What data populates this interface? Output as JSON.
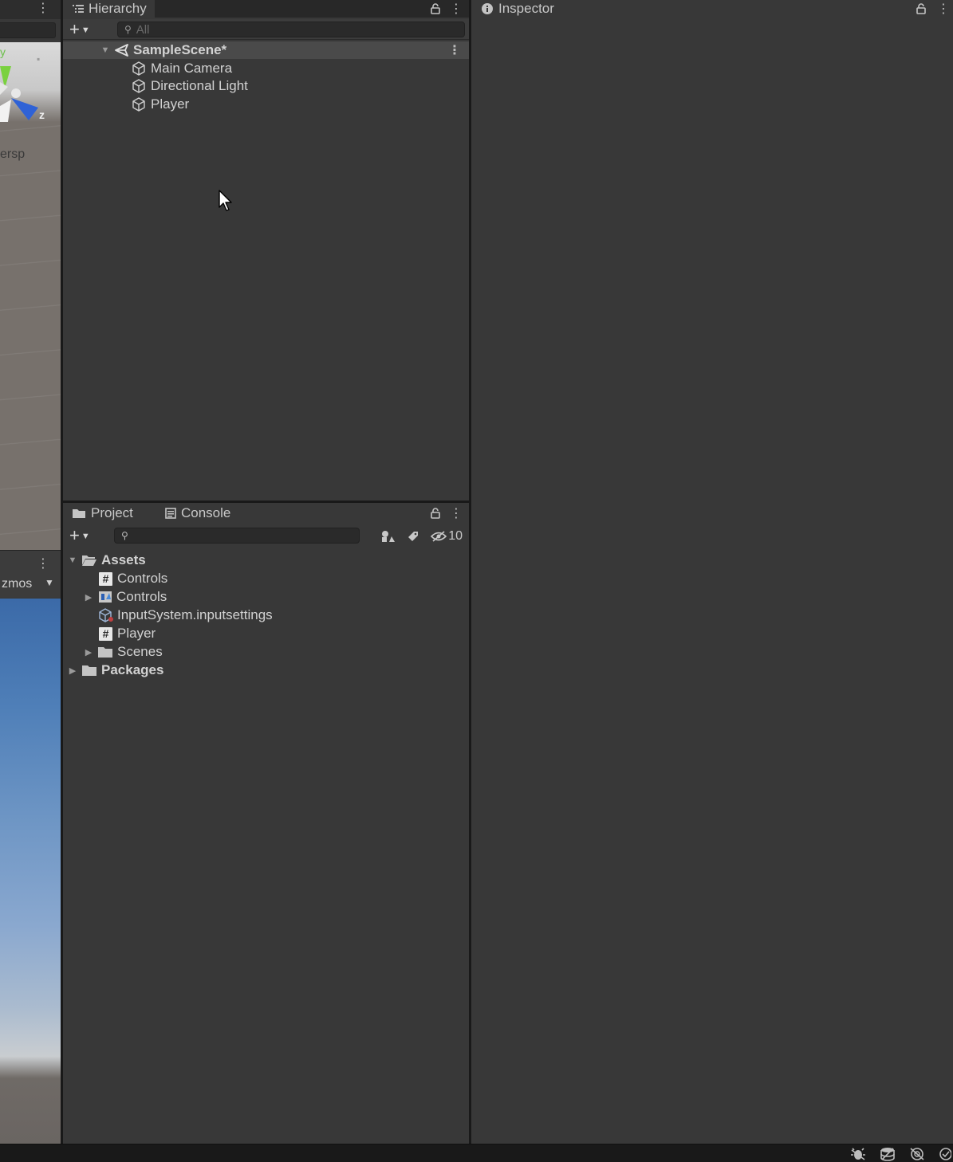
{
  "scene_strip": {
    "persp_label": "ersp",
    "gizmos_label": "zmos",
    "gizmo_axis_label": "z",
    "corner_label": "y"
  },
  "hierarchy": {
    "tab_label": "Hierarchy",
    "search_placeholder": "All",
    "scene_name": "SampleScene*",
    "items": [
      {
        "label": "Main Camera",
        "icon": "gameobject-cube-icon"
      },
      {
        "label": "Directional Light",
        "icon": "gameobject-cube-icon"
      },
      {
        "label": "Player",
        "icon": "gameobject-cube-icon"
      }
    ]
  },
  "project": {
    "tabs": [
      {
        "label": "Project",
        "icon": "folder-icon"
      },
      {
        "label": "Console",
        "icon": "console-icon"
      }
    ],
    "search_placeholder": "",
    "hidden_count": "10",
    "tree": [
      {
        "label": "Assets",
        "icon": "folder-open-icon",
        "expanded": true,
        "bold": true
      },
      {
        "label": "Controls",
        "icon": "csharp-script-icon"
      },
      {
        "label": "Controls",
        "icon": "input-actions-icon",
        "collapsed": true
      },
      {
        "label": "InputSystem.inputsettings",
        "icon": "input-settings-icon"
      },
      {
        "label": "Player",
        "icon": "csharp-script-icon"
      },
      {
        "label": "Scenes",
        "icon": "folder-icon",
        "collapsed": true
      },
      {
        "label": "Packages",
        "icon": "folder-icon",
        "collapsed": true,
        "bold": true
      }
    ]
  },
  "inspector": {
    "tab_label": "Inspector"
  },
  "colors": {
    "panel_bg": "#383838",
    "selected_row": "#4a4a4a",
    "text": "#d2d2d2"
  }
}
